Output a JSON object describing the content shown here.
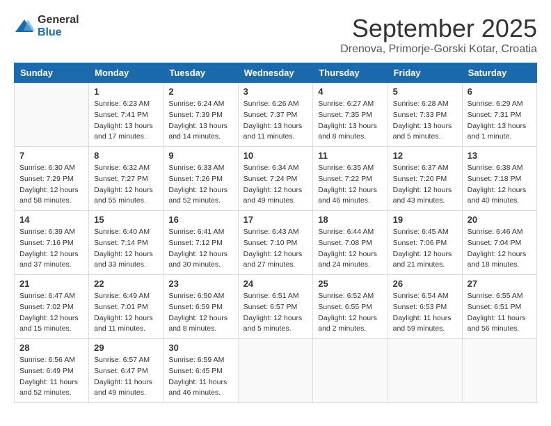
{
  "logo": {
    "general": "General",
    "blue": "Blue"
  },
  "title": "September 2025",
  "location": "Drenova, Primorje-Gorski Kotar, Croatia",
  "headers": [
    "Sunday",
    "Monday",
    "Tuesday",
    "Wednesday",
    "Thursday",
    "Friday",
    "Saturday"
  ],
  "weeks": [
    [
      {
        "day": "",
        "info": ""
      },
      {
        "day": "1",
        "info": "Sunrise: 6:23 AM\nSunset: 7:41 PM\nDaylight: 13 hours\nand 17 minutes."
      },
      {
        "day": "2",
        "info": "Sunrise: 6:24 AM\nSunset: 7:39 PM\nDaylight: 13 hours\nand 14 minutes."
      },
      {
        "day": "3",
        "info": "Sunrise: 6:26 AM\nSunset: 7:37 PM\nDaylight: 13 hours\nand 11 minutes."
      },
      {
        "day": "4",
        "info": "Sunrise: 6:27 AM\nSunset: 7:35 PM\nDaylight: 13 hours\nand 8 minutes."
      },
      {
        "day": "5",
        "info": "Sunrise: 6:28 AM\nSunset: 7:33 PM\nDaylight: 13 hours\nand 5 minutes."
      },
      {
        "day": "6",
        "info": "Sunrise: 6:29 AM\nSunset: 7:31 PM\nDaylight: 13 hours\nand 1 minute."
      }
    ],
    [
      {
        "day": "7",
        "info": "Sunrise: 6:30 AM\nSunset: 7:29 PM\nDaylight: 12 hours\nand 58 minutes."
      },
      {
        "day": "8",
        "info": "Sunrise: 6:32 AM\nSunset: 7:27 PM\nDaylight: 12 hours\nand 55 minutes."
      },
      {
        "day": "9",
        "info": "Sunrise: 6:33 AM\nSunset: 7:26 PM\nDaylight: 12 hours\nand 52 minutes."
      },
      {
        "day": "10",
        "info": "Sunrise: 6:34 AM\nSunset: 7:24 PM\nDaylight: 12 hours\nand 49 minutes."
      },
      {
        "day": "11",
        "info": "Sunrise: 6:35 AM\nSunset: 7:22 PM\nDaylight: 12 hours\nand 46 minutes."
      },
      {
        "day": "12",
        "info": "Sunrise: 6:37 AM\nSunset: 7:20 PM\nDaylight: 12 hours\nand 43 minutes."
      },
      {
        "day": "13",
        "info": "Sunrise: 6:38 AM\nSunset: 7:18 PM\nDaylight: 12 hours\nand 40 minutes."
      }
    ],
    [
      {
        "day": "14",
        "info": "Sunrise: 6:39 AM\nSunset: 7:16 PM\nDaylight: 12 hours\nand 37 minutes."
      },
      {
        "day": "15",
        "info": "Sunrise: 6:40 AM\nSunset: 7:14 PM\nDaylight: 12 hours\nand 33 minutes."
      },
      {
        "day": "16",
        "info": "Sunrise: 6:41 AM\nSunset: 7:12 PM\nDaylight: 12 hours\nand 30 minutes."
      },
      {
        "day": "17",
        "info": "Sunrise: 6:43 AM\nSunset: 7:10 PM\nDaylight: 12 hours\nand 27 minutes."
      },
      {
        "day": "18",
        "info": "Sunrise: 6:44 AM\nSunset: 7:08 PM\nDaylight: 12 hours\nand 24 minutes."
      },
      {
        "day": "19",
        "info": "Sunrise: 6:45 AM\nSunset: 7:06 PM\nDaylight: 12 hours\nand 21 minutes."
      },
      {
        "day": "20",
        "info": "Sunrise: 6:46 AM\nSunset: 7:04 PM\nDaylight: 12 hours\nand 18 minutes."
      }
    ],
    [
      {
        "day": "21",
        "info": "Sunrise: 6:47 AM\nSunset: 7:02 PM\nDaylight: 12 hours\nand 15 minutes."
      },
      {
        "day": "22",
        "info": "Sunrise: 6:49 AM\nSunset: 7:01 PM\nDaylight: 12 hours\nand 11 minutes."
      },
      {
        "day": "23",
        "info": "Sunrise: 6:50 AM\nSunset: 6:59 PM\nDaylight: 12 hours\nand 8 minutes."
      },
      {
        "day": "24",
        "info": "Sunrise: 6:51 AM\nSunset: 6:57 PM\nDaylight: 12 hours\nand 5 minutes."
      },
      {
        "day": "25",
        "info": "Sunrise: 6:52 AM\nSunset: 6:55 PM\nDaylight: 12 hours\nand 2 minutes."
      },
      {
        "day": "26",
        "info": "Sunrise: 6:54 AM\nSunset: 6:53 PM\nDaylight: 11 hours\nand 59 minutes."
      },
      {
        "day": "27",
        "info": "Sunrise: 6:55 AM\nSunset: 6:51 PM\nDaylight: 11 hours\nand 56 minutes."
      }
    ],
    [
      {
        "day": "28",
        "info": "Sunrise: 6:56 AM\nSunset: 6:49 PM\nDaylight: 11 hours\nand 52 minutes."
      },
      {
        "day": "29",
        "info": "Sunrise: 6:57 AM\nSunset: 6:47 PM\nDaylight: 11 hours\nand 49 minutes."
      },
      {
        "day": "30",
        "info": "Sunrise: 6:59 AM\nSunset: 6:45 PM\nDaylight: 11 hours\nand 46 minutes."
      },
      {
        "day": "",
        "info": ""
      },
      {
        "day": "",
        "info": ""
      },
      {
        "day": "",
        "info": ""
      },
      {
        "day": "",
        "info": ""
      }
    ]
  ]
}
